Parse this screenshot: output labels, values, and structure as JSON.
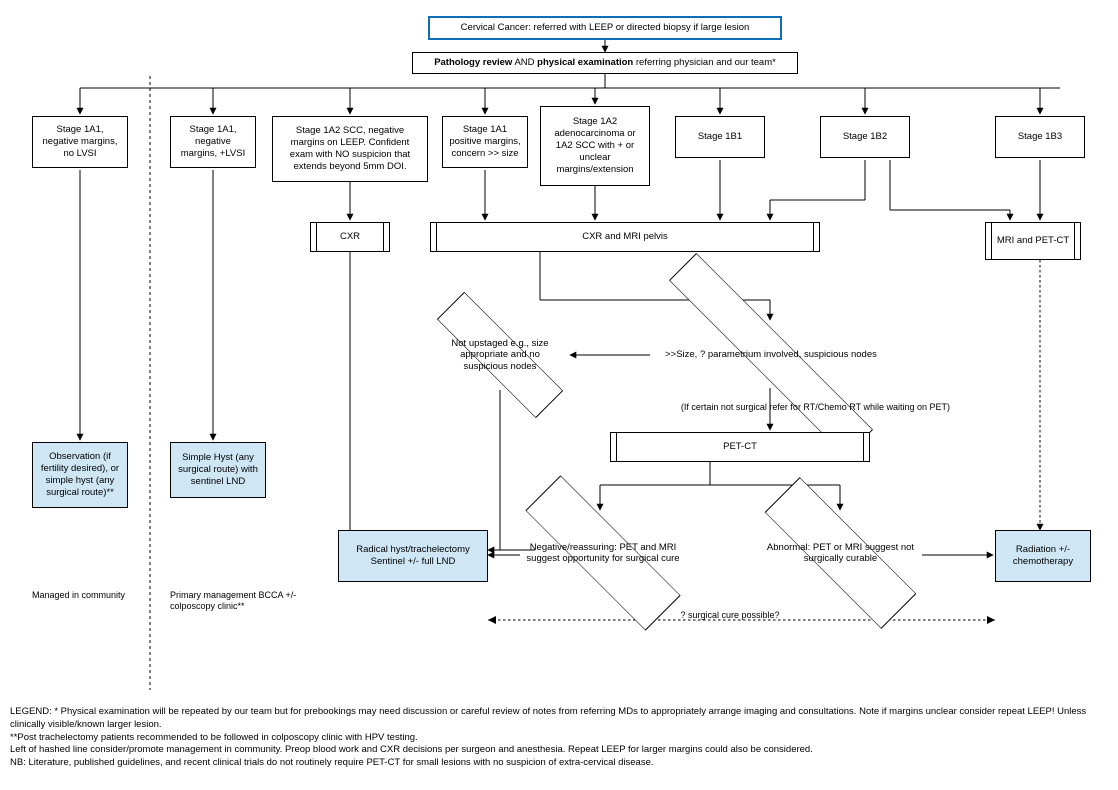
{
  "title": "Cervical Cancer: referred with LEEP or directed biopsy if large lesion",
  "review_prefix": "Pathology review",
  "review_mid": " AND ",
  "review_bold2": "physical examination",
  "review_suffix": " referring physician and our team*",
  "stages": {
    "s1a1_neg_nolvsi": "Stage 1A1, negative margins, no LVSI",
    "s1a1_neg_lvsi": "Stage 1A1, negative margins, +LVSI",
    "s1a2_scc": "Stage 1A2 SCC, negative margins on LEEP. Confident exam with NO suspicion that extends beyond 5mm DOI.",
    "s1a1_pos": "Stage 1A1 positive margins, concern >> size",
    "s1a2_adeno": "Stage 1A2 adenocarcinoma or 1A2 SCC with + or unclear margins/extension",
    "s1b1": "Stage 1B1",
    "s1b2": "Stage 1B2",
    "s1b3": "Stage 1B3"
  },
  "imaging": {
    "cxr": "CXR",
    "cxr_mri": "CXR and MRI pelvis",
    "mri_petct": "MRI and PET-CT",
    "petct": "PET-CT"
  },
  "decisions": {
    "not_upstaged": "Not upstaged e.g., size appropriate and no suspicious nodes",
    "size_param": ">>Size, ? parametrium involved, suspicious nodes",
    "rt_note": "(If certain not surgical refer for RT/Chemo RT while waiting on PET)",
    "neg_reassuring": "Negative/reassuring: PET and MRI suggest opportunity for surgical cure",
    "abnormal": "Abnormal: PET or MRI suggest not surgically curable",
    "surgical_q": "? surgical cure possible?"
  },
  "outcomes": {
    "observation": "Observation (if fertility desired), or simple hyst (any surgical route)**",
    "simple_hyst": "Simple Hyst  (any surgical route) with sentinel LND",
    "radical": "Radical hyst/trachelectomy Sentinel +/- full LND",
    "radiation": "Radiation +/- chemotherapy"
  },
  "management": {
    "community": "Managed in community",
    "bcca": "Primary management BCCA +/- colposcopy clinic**"
  },
  "legend": {
    "l1": "LEGEND: * Physical examination will be repeated by our team but for prebookings may need discussion or careful review of notes from referring MDs to appropriately arrange imaging and consultations. Note if margins unclear consider repeat LEEP! Unless clinically visible/known larger lesion.",
    "l2": "**Post trachelectomy patients recommended to be followed in colposcopy clinic with HPV testing.",
    "l3": "Left of hashed line consider/promote management in community. Preop blood work and CXR decisions per surgeon and anesthesia. Repeat LEEP for larger margins could also be considered.",
    "l4": "NB: Literature, published guidelines, and recent clinical trials do not routinely require PET-CT for small lesions with no suspicion of extra-cervical disease."
  }
}
